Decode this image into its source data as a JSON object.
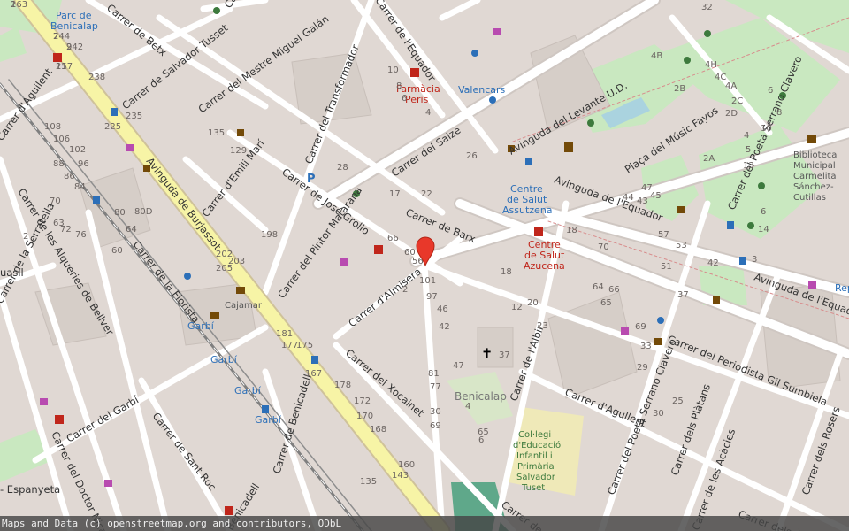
{
  "map": {
    "colors": {
      "background": "#e0d8d3",
      "road": "#ffffff",
      "road_casing": "#cfc7c2",
      "primary_road": "#f7f4a6",
      "park": "#c9e8c0",
      "building": "#d6cec8",
      "water": "#aad3df",
      "rail": "#7f7f7f",
      "marker": "#e8382a"
    },
    "marker": {
      "name": "location-pin",
      "label": "60"
    },
    "streets": [
      {
        "text": "Avinguda de Burjassot"
      },
      {
        "text": "Carrer de la Florista"
      },
      {
        "text": "Carrer de Salvador Tusset"
      },
      {
        "text": "Carrer del Mestre Miguel Galán"
      },
      {
        "text": "Carrer de Betx"
      },
      {
        "text": "Carrer del Transformador"
      },
      {
        "text": "Carrer d'Emili Marí"
      },
      {
        "text": "Carrer de José Grollo"
      },
      {
        "text": "Carrer del Salze"
      },
      {
        "text": "Carrer de Barx"
      },
      {
        "text": "Carrer del Pintor Matarana"
      },
      {
        "text": "Carrer d'Almisera"
      },
      {
        "text": "Avinguda del Levante U.D."
      },
      {
        "text": "Plaça del Músic Fayos"
      },
      {
        "text": "Avinguda de l'Equador"
      },
      {
        "text": "Avinguda de l'Equador"
      },
      {
        "text": "Carrer del Poeta Serrano Clavero"
      },
      {
        "text": "Carrer del Poeta Serrano Clavero"
      },
      {
        "text": "Carrer del Periodista Gil Sumbiela"
      },
      {
        "text": "Carrer d'Agullent"
      },
      {
        "text": "Carrer de l'Albir"
      },
      {
        "text": "Carrer dels Plàtans"
      },
      {
        "text": "Carrer de les Acàcies"
      },
      {
        "text": "Carrer dels Rosers"
      },
      {
        "text": "Carrer dels Àlbers"
      },
      {
        "text": "Carrer del Xocainet"
      },
      {
        "text": "Carrer de Benicadell"
      },
      {
        "text": "Carrer de Sant Roc"
      },
      {
        "text": "Carrer del Garbí"
      },
      {
        "text": "Carrer del Doctor Nicasi"
      },
      {
        "text": "Carrer de les Alqueries de Bellver"
      },
      {
        "text": "Carrer de la Serratella"
      },
      {
        "text": "Carrer d'Aguilent"
      },
      {
        "text": "Carrer de l'Equador"
      },
      {
        "text": "Carrer de Raga"
      },
      {
        "text": "Carrer de José"
      },
      {
        "text": "Benicadell"
      },
      {
        "text": "- Espanyeta"
      },
      {
        "text": "uasil"
      }
    ],
    "places": [
      {
        "text": "Parc de"
      },
      {
        "text": "Benicalap"
      },
      {
        "text": "Farmàcia"
      },
      {
        "text": "Peris"
      },
      {
        "text": "Valencars"
      },
      {
        "text": "Centre"
      },
      {
        "text": "de Salut"
      },
      {
        "text": "Assutzena"
      },
      {
        "text": "Centre"
      },
      {
        "text": "de Salut"
      },
      {
        "text": "Azucena"
      },
      {
        "text": "Biblioteca"
      },
      {
        "text": "Municipal"
      },
      {
        "text": "Carmelita"
      },
      {
        "text": "Sánchez-"
      },
      {
        "text": "Cutillas"
      },
      {
        "text": "Benicalap"
      },
      {
        "text": "Cajamar"
      },
      {
        "text": "Garbí"
      },
      {
        "text": "Garbí"
      },
      {
        "text": "Garbí"
      },
      {
        "text": "Garbí"
      },
      {
        "text": "Col·legi"
      },
      {
        "text": "d'Educació"
      },
      {
        "text": "Infantil i"
      },
      {
        "text": "Primària"
      },
      {
        "text": "Salvador"
      },
      {
        "text": "Tuset"
      },
      {
        "text": "Rep"
      }
    ],
    "house_numbers": [
      "263",
      "244",
      "242",
      "257",
      "238",
      "225",
      "235",
      "108",
      "106",
      "102",
      "96",
      "88",
      "86",
      "84",
      "80",
      "80D",
      "64",
      "60",
      "72",
      "76",
      "70",
      "63",
      "135",
      "129",
      "2",
      "202",
      "203",
      "205",
      "198",
      "181",
      "177",
      "175",
      "167",
      "178",
      "172",
      "170",
      "168",
      "160",
      "143",
      "135",
      "10",
      "8",
      "6",
      "4",
      "28",
      "17",
      "22",
      "26",
      "66",
      "60",
      "56",
      "101",
      "97",
      "46",
      "42",
      "37",
      "47",
      "81",
      "77",
      "30",
      "69",
      "65",
      "6",
      "4",
      "2",
      "12",
      "18",
      "20",
      "23",
      "18",
      "70",
      "64",
      "66",
      "65",
      "69",
      "57",
      "53",
      "51",
      "47",
      "45",
      "44",
      "43",
      "42",
      "37",
      "33",
      "29",
      "25",
      "30",
      "32",
      "4H",
      "4C",
      "4A",
      "4B",
      "2B",
      "2A",
      "2C",
      "2D",
      "6",
      "8",
      "10",
      "13",
      "14",
      "3",
      "6",
      "5",
      "4",
      "1",
      "7",
      "9",
      "11"
    ],
    "attribution": "Maps and Data (c) openstreetmap.org and contributors, ODbL"
  }
}
